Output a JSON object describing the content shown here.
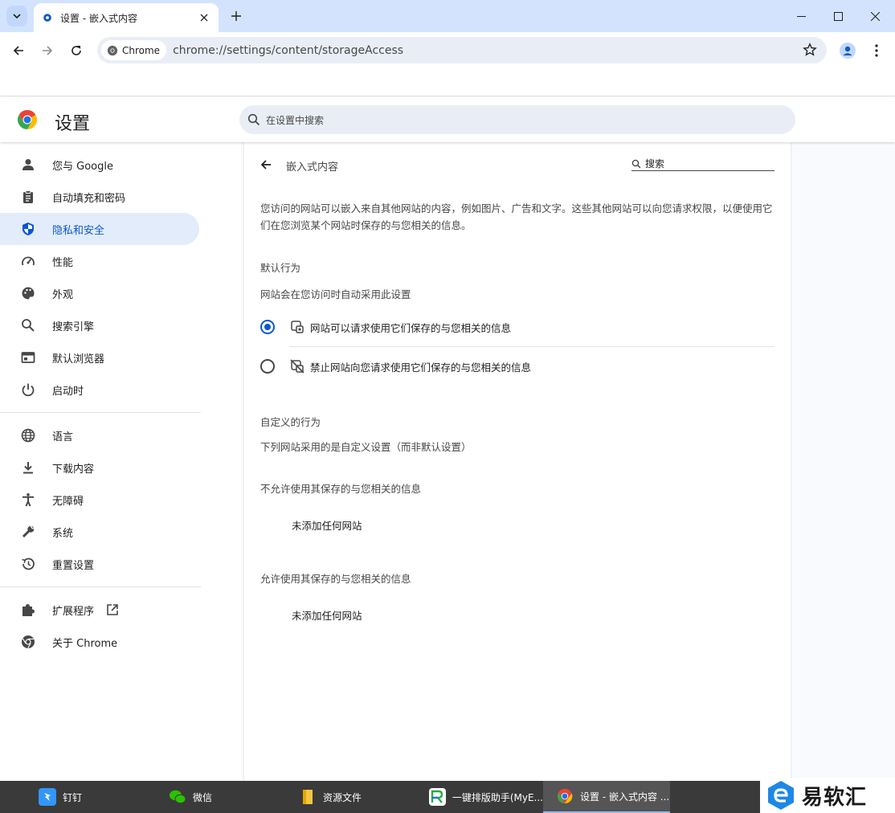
{
  "browser": {
    "tab_title": "设置 - 嵌入式内容",
    "chip_label": "Chrome",
    "url": "chrome://settings/content/storageAccess"
  },
  "header": {
    "title": "设置",
    "search_placeholder": "在设置中搜索"
  },
  "sidebar": {
    "items": [
      {
        "label": "您与 Google",
        "icon": "person-icon"
      },
      {
        "label": "自动填充和密码",
        "icon": "clipboard-icon"
      },
      {
        "label": "隐私和安全",
        "icon": "shield-icon"
      },
      {
        "label": "性能",
        "icon": "speedometer-icon"
      },
      {
        "label": "外观",
        "icon": "palette-icon"
      },
      {
        "label": "搜索引擎",
        "icon": "search-icon"
      },
      {
        "label": "默认浏览器",
        "icon": "browser-icon"
      },
      {
        "label": "启动时",
        "icon": "power-icon"
      },
      {
        "label": "语言",
        "icon": "globe-icon"
      },
      {
        "label": "下载内容",
        "icon": "download-icon"
      },
      {
        "label": "无障碍",
        "icon": "accessibility-icon"
      },
      {
        "label": "系统",
        "icon": "wrench-icon"
      },
      {
        "label": "重置设置",
        "icon": "history-icon"
      },
      {
        "label": "扩展程序",
        "icon": "puzzle-icon"
      },
      {
        "label": "关于 Chrome",
        "icon": "chrome-icon"
      }
    ],
    "active_index": 2
  },
  "content": {
    "title": "嵌入式内容",
    "search_placeholder": "搜索",
    "description": "您访问的网站可以嵌入来自其他网站的内容，例如图片、广告和文字。这些其他网站可以向您请求权限，以便使用它们在您浏览某个网站时保存的与您相关的信息。",
    "default_heading": "默认行为",
    "default_sub": "网站会在您访问时自动采用此设置",
    "option_allow": "网站可以请求使用它们保存的与您相关的信息",
    "option_block": "禁止网站向您请求使用它们保存的与您相关的信息",
    "custom_heading": "自定义的行为",
    "custom_sub": "下列网站采用的是自定义设置（而非默认设置）",
    "blocked_heading": "不允许使用其保存的与您相关的信息",
    "blocked_empty": "未添加任何网站",
    "allowed_heading": "允许使用其保存的与您相关的信息",
    "allowed_empty": "未添加任何网站"
  },
  "taskbar": {
    "items": [
      "钉钉",
      "微信",
      "资源文件",
      "一键排版助手(MyE...",
      "设置 - 嵌入式内容 ..."
    ],
    "brand": "易软汇"
  },
  "colors": {
    "accent": "#0b57d0",
    "titlebar": "#d3e3fd",
    "active_nav": "#e3ecfb"
  }
}
